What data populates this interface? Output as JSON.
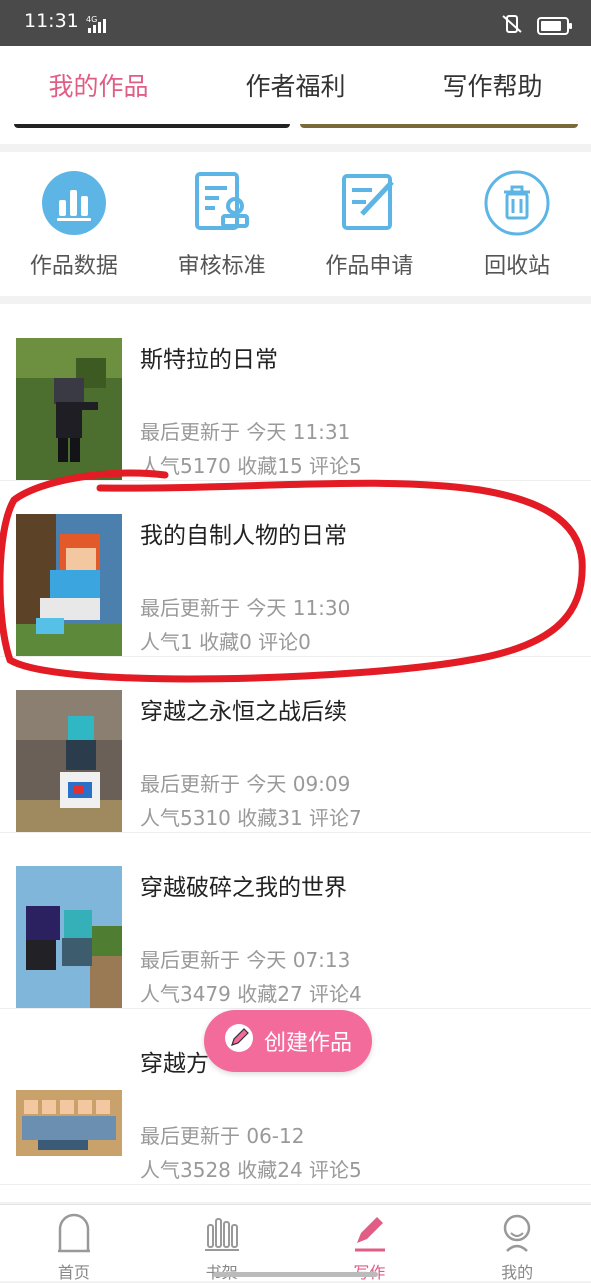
{
  "status": {
    "time": "11:31",
    "network": "4G"
  },
  "tabs": [
    {
      "label": "我的作品",
      "active": true
    },
    {
      "label": "作者福利",
      "active": false
    },
    {
      "label": "写作帮助",
      "active": false
    }
  ],
  "quick_actions": [
    {
      "label": "作品数据",
      "icon": "bar-chart-icon"
    },
    {
      "label": "审核标准",
      "icon": "review-document-icon"
    },
    {
      "label": "作品申请",
      "icon": "edit-document-icon"
    },
    {
      "label": "回收站",
      "icon": "trash-icon"
    }
  ],
  "works": [
    {
      "title": "斯特拉的日常",
      "updated": "最后更新于 今天 11:31",
      "stats": "人气5170  收藏15  评论5"
    },
    {
      "title": "我的自制人物的日常",
      "updated": "最后更新于 今天 11:30",
      "stats": "人气1  收藏0  评论0"
    },
    {
      "title": "穿越之永恒之战后续",
      "updated": "最后更新于 今天 09:09",
      "stats": "人气5310  收藏31  评论7"
    },
    {
      "title": "穿越破碎之我的世界",
      "updated": "最后更新于 今天 07:13",
      "stats": "人气3479  收藏27  评论4"
    },
    {
      "title": "穿越方",
      "updated": "最后更新于 06-12",
      "stats": "人气3528  收藏24  评论5"
    }
  ],
  "fab": {
    "label": "创建作品"
  },
  "bottom_nav": [
    {
      "label": "首页",
      "icon": "home-icon"
    },
    {
      "label": "书架",
      "icon": "bookshelf-icon"
    },
    {
      "label": "写作",
      "icon": "pen-icon",
      "active": true
    },
    {
      "label": "我的",
      "icon": "profile-icon"
    }
  ],
  "colors": {
    "accent": "#e05d86",
    "fab": "#f26b9a",
    "icon_blue": "#5db5e6",
    "annotation": "#e21b24"
  }
}
